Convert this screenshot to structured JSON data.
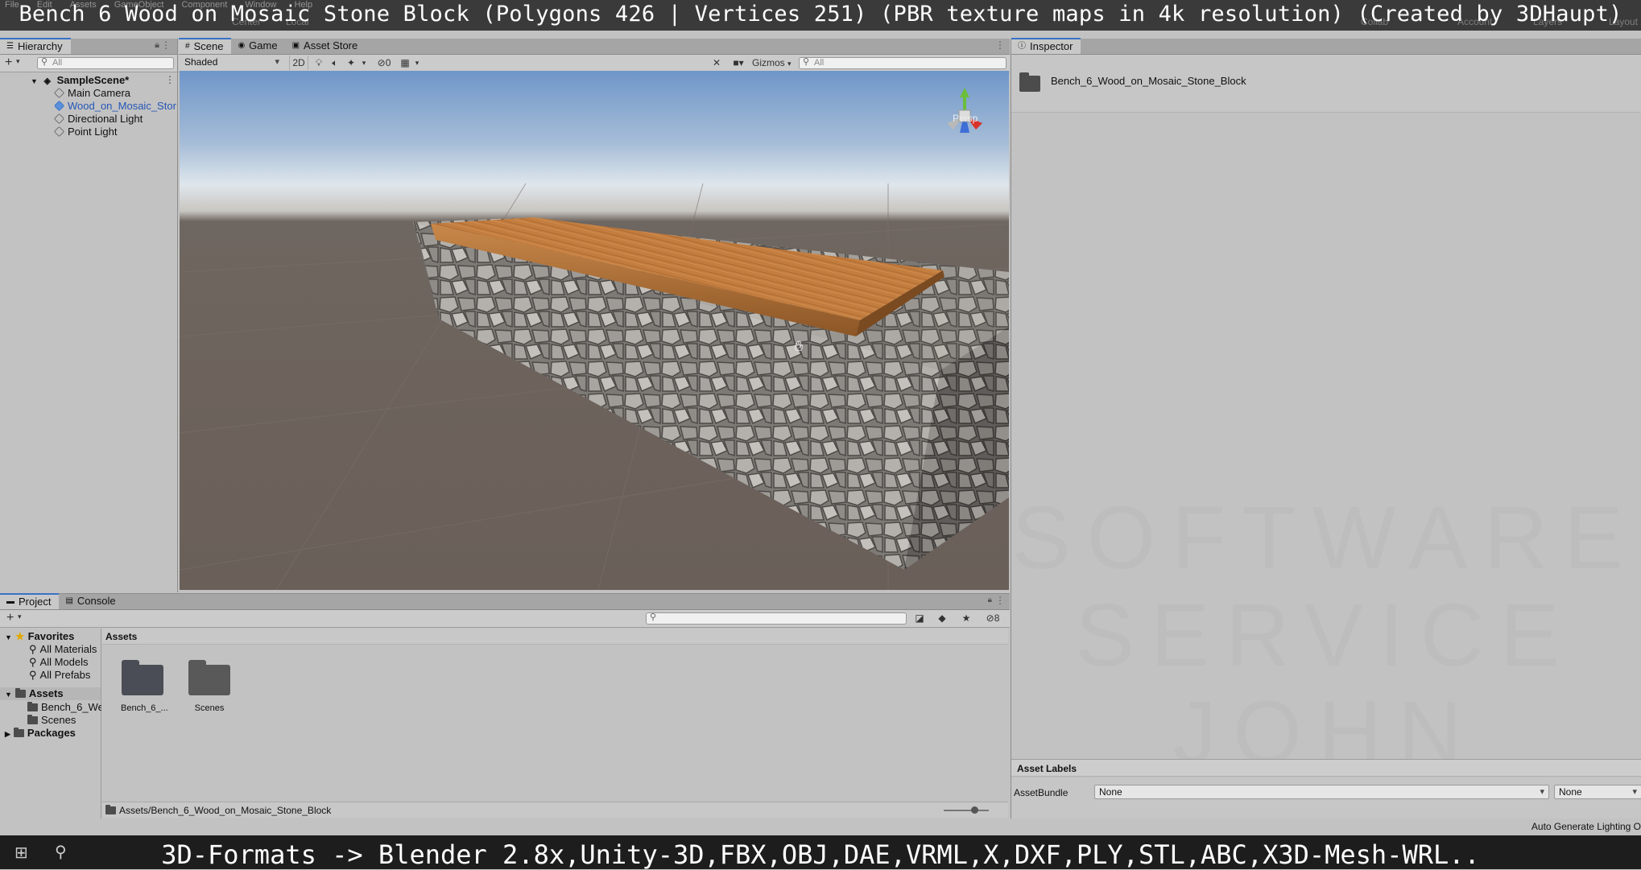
{
  "caption": {
    "title": "Bench 6 Wood on Mosaic Stone Block (Polygons 426 | Vertices 251) (PBR texture maps in 4k resolution) (Created by 3DHaupt)",
    "menu": [
      "File",
      "Edit",
      "Assets",
      "GameObject",
      "Component",
      "Window",
      "Help"
    ],
    "center_label": "Center",
    "local_label": "Local",
    "collab_label": "Collab",
    "account_label": "Account",
    "layers_label": "Layers",
    "layout_label": "Layout"
  },
  "hierarchy": {
    "tab_label": "Hierarchy",
    "search_placeholder": "All",
    "scene_name": "SampleScene*",
    "items": [
      "Main Camera",
      "Wood_on_Mosaic_Stor",
      "Directional Light",
      "Point Light"
    ]
  },
  "scene_tabs": [
    "Scene",
    "Game",
    "Asset Store"
  ],
  "scene_toolbar": {
    "shading_mode": "Shaded",
    "mode_2d": "2D",
    "hidden_count": "0",
    "gizmos_label": "Gizmos",
    "search_placeholder": "All",
    "persp_label": "Persp"
  },
  "inspector": {
    "tab_label": "Inspector",
    "asset_name": "Bench_6_Wood_on_Mosaic_Stone_Block",
    "asset_labels_heading": "Asset Labels",
    "assetbundle_label": "AssetBundle",
    "assetbundle_value": "None",
    "variant_value": "None",
    "auto_lighting": "Auto Generate Lighting O"
  },
  "project": {
    "tabs": [
      "Project",
      "Console"
    ],
    "hidden_count": "8",
    "favorites_label": "Favorites",
    "favorites": [
      "All Materials",
      "All Models",
      "All Prefabs"
    ],
    "assets_label": "Assets",
    "asset_folders": [
      "Bench_6_We",
      "Scenes"
    ],
    "packages_label": "Packages",
    "breadcrumb": "Assets",
    "grid_items": [
      "Bench_6_...",
      "Scenes"
    ],
    "path": "Assets/Bench_6_Wood_on_Mosaic_Stone_Block"
  },
  "taskbar": {
    "text": "3D-Formats -> Blender 2.8x,Unity-3D,FBX,OBJ,DAE,VRML,X,DXF,PLY,STL,ABC,X3D-Mesh-WRL.."
  },
  "watermark": {
    "lines": [
      "SOFTWARE",
      "SERVICE",
      "JOHN"
    ]
  },
  "colors": {
    "accent": "#3a72c6",
    "selected_text": "#2456b8",
    "panel_bg": "#c2c2c2",
    "wood": "#c07a3c",
    "stone": "#8f8c88"
  }
}
